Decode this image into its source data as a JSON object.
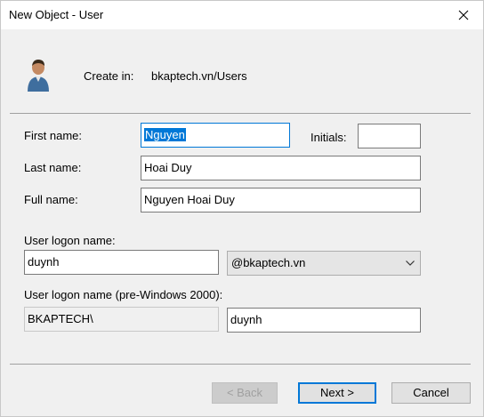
{
  "window": {
    "title": "New Object - User"
  },
  "header": {
    "create_in_label": "Create in:",
    "create_in_path": "bkaptech.vn/Users"
  },
  "form": {
    "first_name_label": "First name:",
    "first_name_value": "Nguyen",
    "initials_label": "Initials:",
    "initials_value": "",
    "last_name_label": "Last name:",
    "last_name_value": "Hoai Duy",
    "full_name_label": "Full name:",
    "full_name_value": "Nguyen Hoai Duy",
    "logon_label": "User logon name:",
    "logon_value": "duynh",
    "domain_suffix": "@bkaptech.vn",
    "pre2000_label": "User logon name (pre-Windows 2000):",
    "pre2000_domain": "BKAPTECH\\",
    "pre2000_value": "duynh"
  },
  "buttons": {
    "back": "< Back",
    "next": "Next >",
    "cancel": "Cancel"
  },
  "colors": {
    "accent": "#0078d7",
    "dialog_bg": "#f0f0f0"
  },
  "icons": {
    "close": "close-icon",
    "user": "user-icon",
    "dropdown": "chevron-down-icon"
  }
}
